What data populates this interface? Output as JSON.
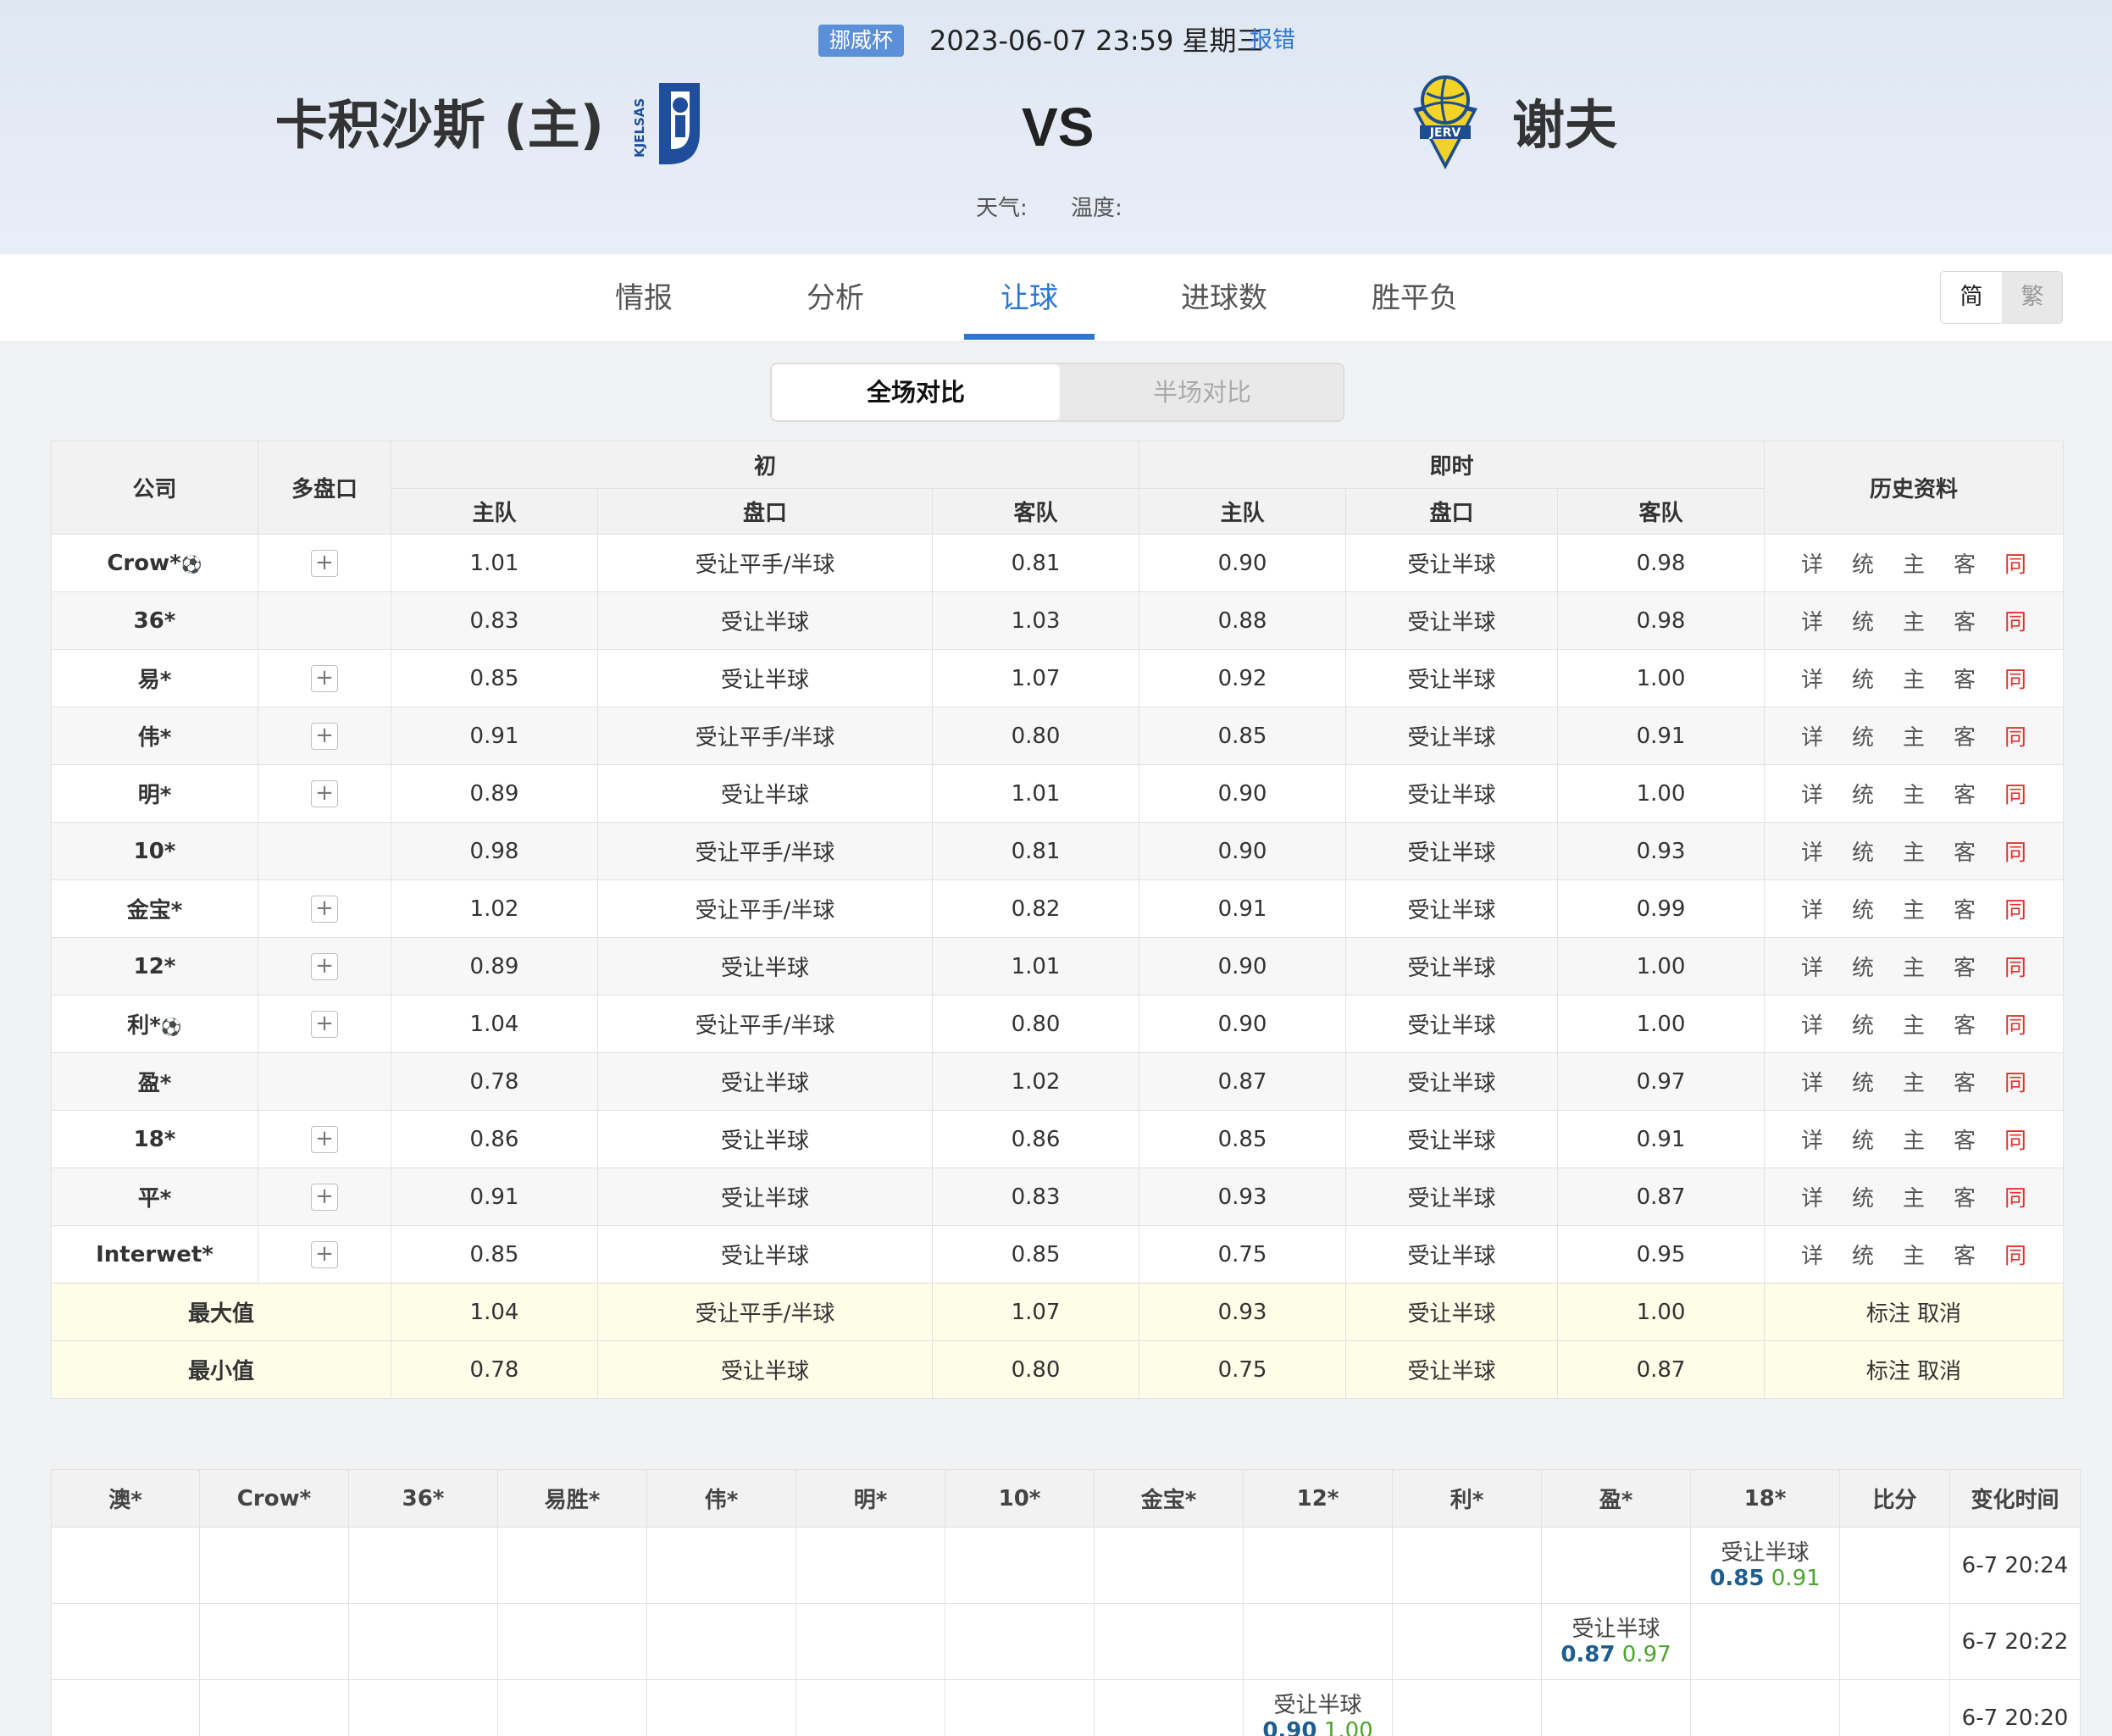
{
  "match": {
    "league": "挪威杯",
    "datetime": "2023-06-07 23:59 星期三",
    "report": "报错",
    "home": "卡积沙斯 (主)",
    "vs": "VS",
    "away": "谢夫",
    "away_logo_text": "JERV",
    "home_logo_text": "KJELSÅS",
    "weather_label": "天气:",
    "temp_label": "温度:"
  },
  "tabs": [
    "情报",
    "分析",
    "让球",
    "进球数",
    "胜平负"
  ],
  "active_tab": "让球",
  "lang": {
    "simplified": "简",
    "traditional": "繁"
  },
  "segment": {
    "full": "全场对比",
    "half": "半场对比"
  },
  "odds": {
    "headers": {
      "company": "公司",
      "multi": "多盘口",
      "initial": "初",
      "live": "即时",
      "history": "历史资料",
      "home": "主队",
      "line": "盘口",
      "away": "客队"
    },
    "history_links": [
      "详",
      "统",
      "主",
      "客",
      "同"
    ],
    "rows": [
      {
        "company": "Crow*",
        "ball": true,
        "multi": true,
        "i_home": "1.01",
        "i_line": "受让平手/半球",
        "i_away": "0.81",
        "l_home": "0.90",
        "l_line": "受让半球",
        "l_away": "0.98"
      },
      {
        "company": "36*",
        "ball": false,
        "multi": false,
        "i_home": "0.83",
        "i_line": "受让半球",
        "i_away": "1.03",
        "l_home": "0.88",
        "l_line": "受让半球",
        "l_away": "0.98"
      },
      {
        "company": "易*",
        "ball": false,
        "multi": true,
        "i_home": "0.85",
        "i_line": "受让半球",
        "i_away": "1.07",
        "l_home": "0.92",
        "l_line": "受让半球",
        "l_away": "1.00"
      },
      {
        "company": "伟*",
        "ball": false,
        "multi": true,
        "i_home": "0.91",
        "i_line": "受让平手/半球",
        "i_away": "0.80",
        "l_home": "0.85",
        "l_line": "受让半球",
        "l_away": "0.91"
      },
      {
        "company": "明*",
        "ball": false,
        "multi": true,
        "i_home": "0.89",
        "i_line": "受让半球",
        "i_away": "1.01",
        "l_home": "0.90",
        "l_line": "受让半球",
        "l_away": "1.00"
      },
      {
        "company": "10*",
        "ball": false,
        "multi": false,
        "i_home": "0.98",
        "i_line": "受让平手/半球",
        "i_away": "0.81",
        "l_home": "0.90",
        "l_line": "受让半球",
        "l_away": "0.93"
      },
      {
        "company": "金宝*",
        "ball": false,
        "multi": true,
        "i_home": "1.02",
        "i_line": "受让平手/半球",
        "i_away": "0.82",
        "l_home": "0.91",
        "l_line": "受让半球",
        "l_away": "0.99"
      },
      {
        "company": "12*",
        "ball": false,
        "multi": true,
        "i_home": "0.89",
        "i_line": "受让半球",
        "i_away": "1.01",
        "l_home": "0.90",
        "l_line": "受让半球",
        "l_away": "1.00"
      },
      {
        "company": "利*",
        "ball": true,
        "multi": true,
        "i_home": "1.04",
        "i_line": "受让平手/半球",
        "i_away": "0.80",
        "l_home": "0.90",
        "l_line": "受让半球",
        "l_away": "1.00"
      },
      {
        "company": "盈*",
        "ball": false,
        "multi": false,
        "i_home": "0.78",
        "i_line": "受让半球",
        "i_away": "1.02",
        "l_home": "0.87",
        "l_line": "受让半球",
        "l_away": "0.97"
      },
      {
        "company": "18*",
        "ball": false,
        "multi": true,
        "i_home": "0.86",
        "i_line": "受让半球",
        "i_away": "0.86",
        "l_home": "0.85",
        "l_line": "受让半球",
        "l_away": "0.91"
      },
      {
        "company": "平*",
        "ball": false,
        "multi": true,
        "i_home": "0.91",
        "i_line": "受让半球",
        "i_away": "0.83",
        "l_home": "0.93",
        "l_line": "受让半球",
        "l_away": "0.87"
      },
      {
        "company": "Interwet*",
        "ball": false,
        "multi": true,
        "i_home": "0.85",
        "i_line": "受让半球",
        "i_away": "0.85",
        "l_home": "0.75",
        "l_line": "受让半球",
        "l_away": "0.95"
      }
    ],
    "stats": [
      {
        "label": "最大值",
        "i_home": "1.04",
        "i_line": "受让平手/半球",
        "i_away": "1.07",
        "l_home": "0.93",
        "l_line": "受让半球",
        "l_away": "1.00",
        "mark": "标注",
        "cancel": "取消"
      },
      {
        "label": "最小值",
        "i_home": "0.78",
        "i_line": "受让半球",
        "i_away": "0.80",
        "l_home": "0.75",
        "l_line": "受让半球",
        "l_away": "0.87",
        "mark": "标注",
        "cancel": "取消"
      }
    ]
  },
  "changes": {
    "headers": [
      "澳*",
      "Crow*",
      "36*",
      "易胜*",
      "伟*",
      "明*",
      "10*",
      "金宝*",
      "12*",
      "利*",
      "盈*",
      "18*",
      "比分",
      "变化时间"
    ],
    "rows": [
      {
        "col": 11,
        "line": "受让半球",
        "home": "0.85",
        "away": "0.91",
        "time": "6-7 20:24"
      },
      {
        "col": 10,
        "line": "受让半球",
        "home": "0.87",
        "away": "0.97",
        "time": "6-7 20:22"
      },
      {
        "col": 8,
        "line": "受让半球",
        "home": "0.90",
        "away": "1.00",
        "time": "6-7 20:20"
      }
    ]
  },
  "colors": {
    "accent": "#2d77d2",
    "league_badge": "#5b8fd8",
    "history_red": "#e0332e",
    "home_value": "#1d5d8f",
    "away_value": "#4aa62b",
    "stat_row": "#fdfde8"
  }
}
